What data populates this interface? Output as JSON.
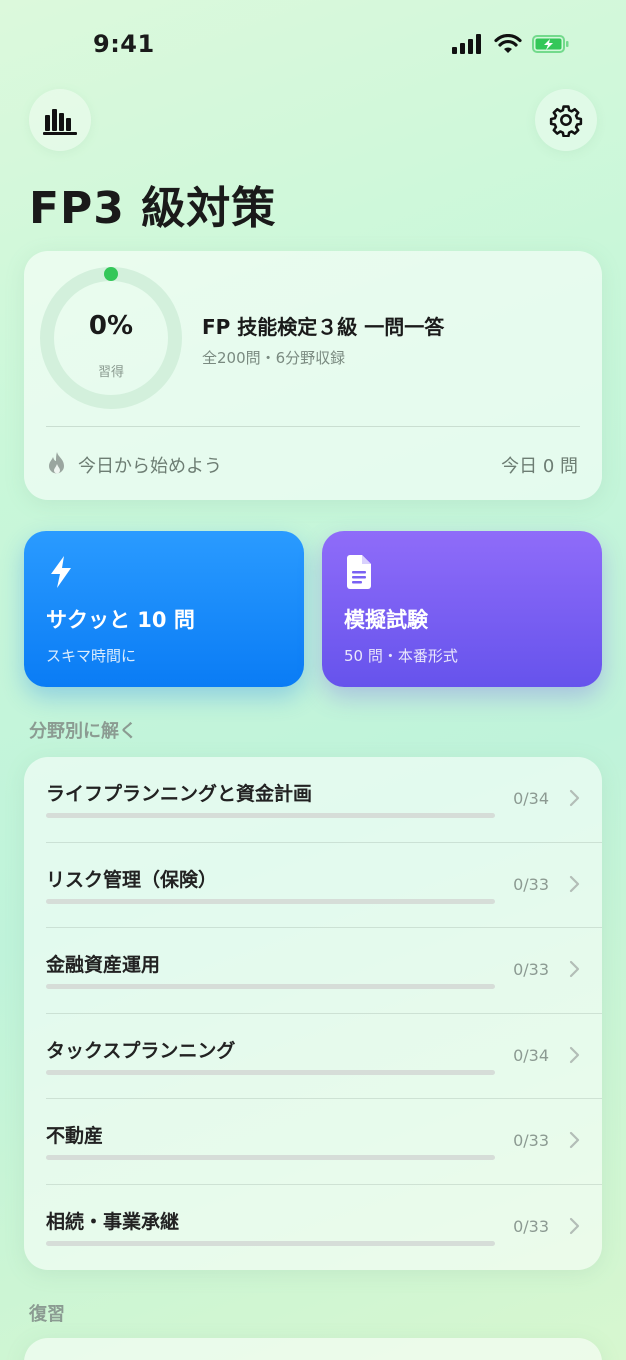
{
  "status_bar": {
    "time": "9:41"
  },
  "header": {
    "stats_icon": "bar-chart-icon",
    "settings_icon": "gear-icon",
    "title": "FP3 級対策"
  },
  "progress_card": {
    "percent_text": "0%",
    "percent_label": "習得",
    "progress": 0,
    "title": "FP 技能検定３級 一問一答",
    "subtitle": "全200問・6分野収録",
    "streak_icon": "flame-icon",
    "streak_text": "今日から始めよう",
    "today_text": "今日 0 問"
  },
  "actions": [
    {
      "icon": "lightning-icon",
      "title": "サクッと 10 問",
      "subtitle": "スキマ時間に",
      "color": "#0a84ff"
    },
    {
      "icon": "document-icon",
      "title": "模擬試験",
      "subtitle": "50 問・本番形式",
      "color": "#6e5cf0"
    }
  ],
  "sections": {
    "by_field": "分野別に解く",
    "review": "復習"
  },
  "fields": [
    {
      "label": "ライフプランニングと資金計画",
      "count": "0/34",
      "progress": 0
    },
    {
      "label": "リスク管理（保険）",
      "count": "0/33",
      "progress": 0
    },
    {
      "label": "金融資産運用",
      "count": "0/33",
      "progress": 0
    },
    {
      "label": "タックスプランニング",
      "count": "0/34",
      "progress": 0
    },
    {
      "label": "不動産",
      "count": "0/33",
      "progress": 0
    },
    {
      "label": "相続・事業承継",
      "count": "0/33",
      "progress": 0
    }
  ],
  "colors": {
    "accent_green": "#34c759",
    "blue": "#0a84ff",
    "purple": "#6e5cf0"
  }
}
